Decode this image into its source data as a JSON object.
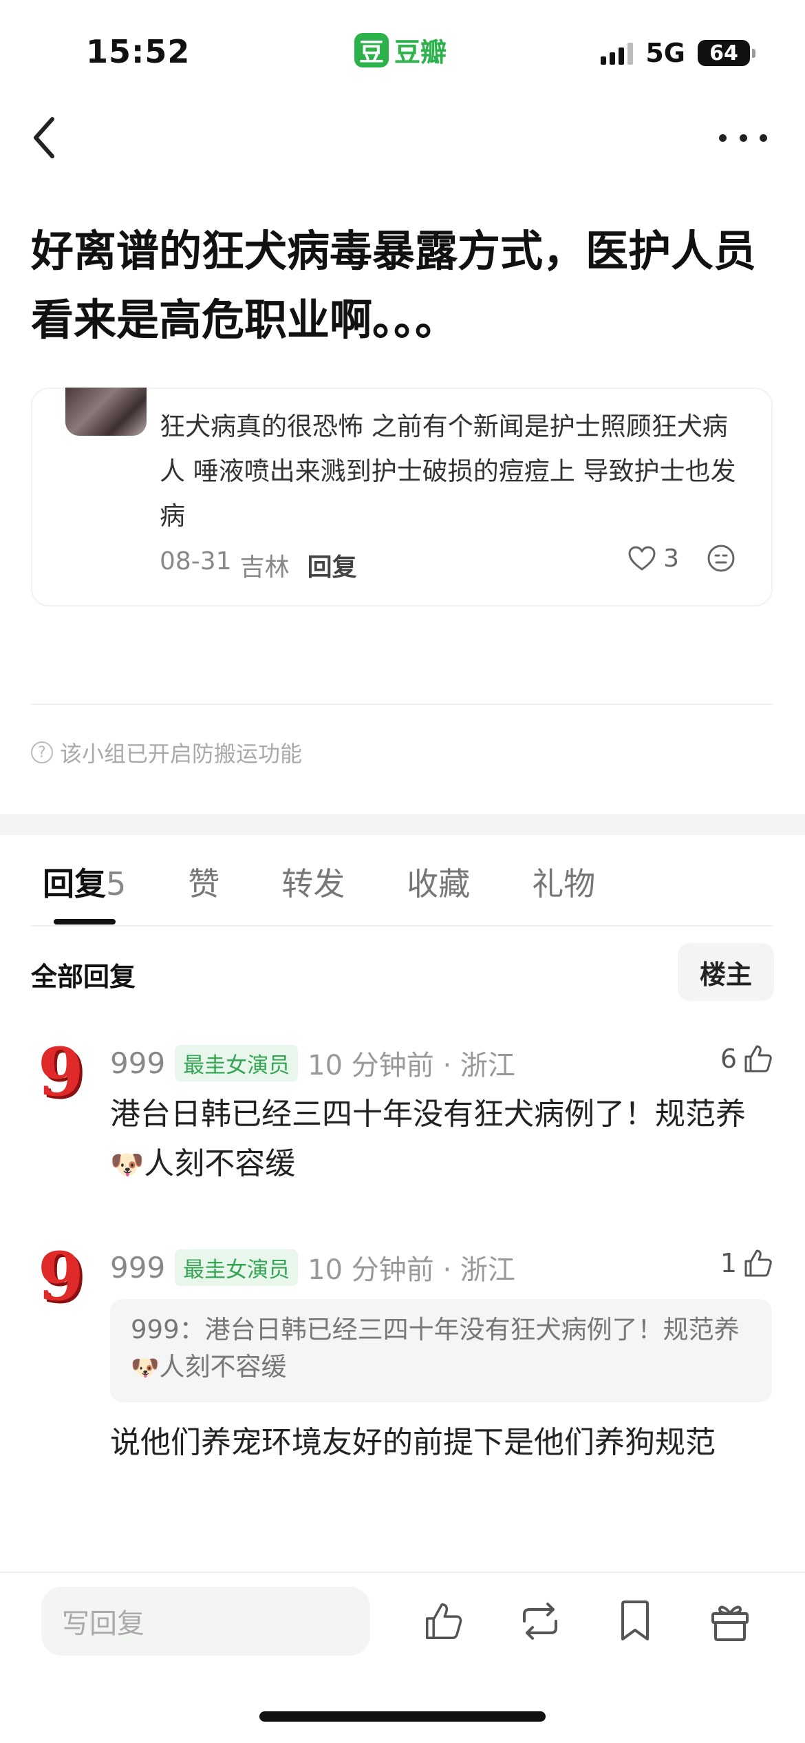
{
  "status_bar": {
    "time": "15:52",
    "app_logo_char": "豆",
    "app_name": "豆瓣",
    "network": "5G",
    "battery": "64"
  },
  "nav": {
    "back_icon": "chevron-left-icon",
    "more_icon": "ellipsis-icon"
  },
  "post": {
    "title": "好离谱的狂犬病毒暴露方式，医护人员看来是高危职业啊。。。"
  },
  "quoted_comment": {
    "text": "狂犬病真的很恐怖 之前有个新闻是护士照顾狂犬病人 唾液喷出来溅到护士破损的痘痘上 导致护士也发病",
    "date": "08-31",
    "location": "吉林",
    "reply_label": "回复",
    "likes": "3"
  },
  "notice": "该小组已开启防搬运功能",
  "tabs": [
    {
      "label": "回复",
      "count": "5"
    },
    {
      "label": "赞"
    },
    {
      "label": "转发"
    },
    {
      "label": "收藏"
    },
    {
      "label": "礼物"
    }
  ],
  "replies_header": {
    "label": "全部回复",
    "owner_filter": "楼主"
  },
  "comments": [
    {
      "avatar_char": "9",
      "name": "999",
      "badge": "最圭女演员",
      "time": "10 分钟前 · 浙江",
      "likes": "6",
      "text_before": "港台日韩已经三四十年没有狂犬病例了！规范养",
      "emoji": "🐶",
      "text_after": "人刻不容缓"
    },
    {
      "avatar_char": "9",
      "name": "999",
      "badge": "最圭女演员",
      "time": "10 分钟前 · 浙江",
      "likes": "1",
      "quote_before": "999：港台日韩已经三四十年没有狂犬病例了！规范养",
      "quote_emoji": "🐶",
      "quote_after": "人刻不容缓",
      "text": "说他们养宠环境友好的前提下是他们养狗规范"
    }
  ],
  "bottom_bar": {
    "input_placeholder": "写回复",
    "icons": [
      "thumbs-up-icon",
      "repost-icon",
      "bookmark-icon",
      "gift-icon"
    ]
  },
  "colors": {
    "brand_green": "#2cb24a",
    "badge_bg": "#e8f6ec",
    "badge_text": "#35a553"
  }
}
